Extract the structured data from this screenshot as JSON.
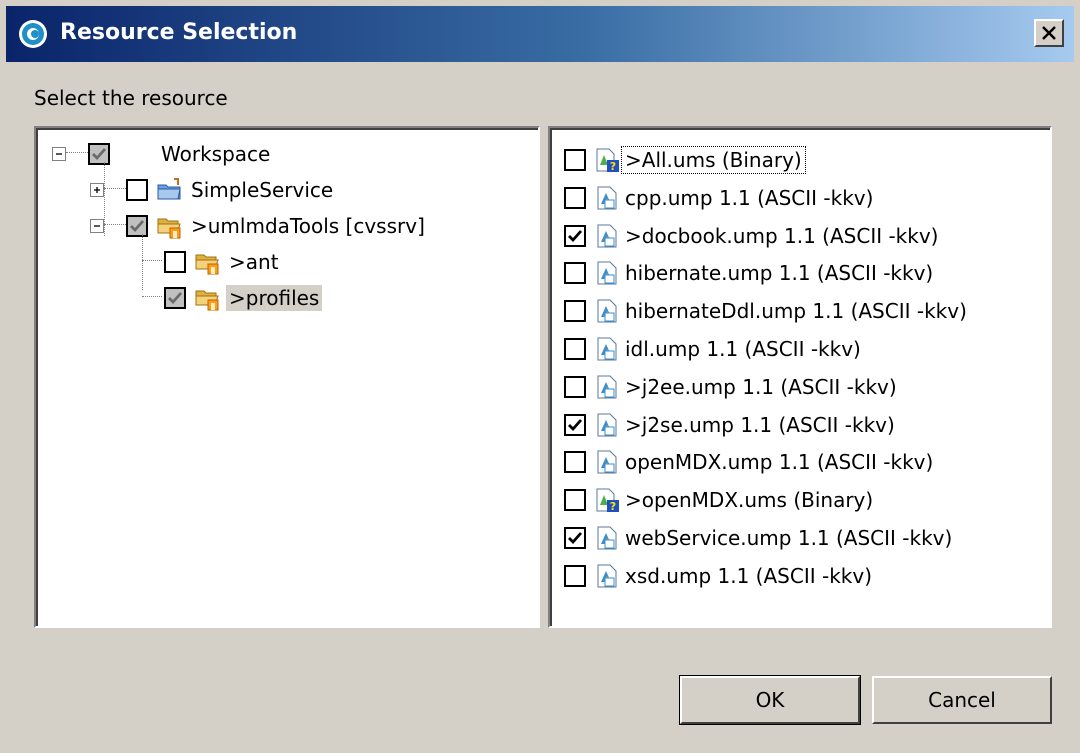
{
  "window": {
    "title": "Resource Selection"
  },
  "prompt": "Select the resource",
  "tree": [
    {
      "label": "Workspace",
      "state": "grayed",
      "expander": "minus",
      "icon": "none"
    },
    {
      "label": "SimpleService",
      "state": "unchecked",
      "expander": "plus",
      "icon": "project-folder-icon"
    },
    {
      "label": ">umlmdaTools  [cvssrv]",
      "state": "grayed",
      "expander": "minus",
      "icon": "shared-folder-icon"
    },
    {
      "label": ">ant",
      "state": "unchecked",
      "expander": "none",
      "icon": "shared-folder-icon"
    },
    {
      "label": ">profiles",
      "state": "grayed",
      "expander": "none",
      "icon": "shared-folder-icon",
      "selected": true
    }
  ],
  "files": [
    {
      "label": ">All.ums   (Binary)",
      "checked": false,
      "icon": "unknown-file-icon",
      "focused": true
    },
    {
      "label": "cpp.ump  1.1  (ASCII -kkv)",
      "checked": false,
      "icon": "ump-file-icon"
    },
    {
      "label": ">docbook.ump  1.1  (ASCII -kkv)",
      "checked": true,
      "icon": "ump-file-icon"
    },
    {
      "label": "hibernate.ump  1.1  (ASCII -kkv)",
      "checked": false,
      "icon": "ump-file-icon"
    },
    {
      "label": "hibernateDdl.ump  1.1  (ASCII -kkv)",
      "checked": false,
      "icon": "ump-file-icon"
    },
    {
      "label": "idl.ump  1.1  (ASCII -kkv)",
      "checked": false,
      "icon": "ump-file-icon"
    },
    {
      "label": ">j2ee.ump  1.1  (ASCII -kkv)",
      "checked": false,
      "icon": "ump-file-icon"
    },
    {
      "label": ">j2se.ump  1.1  (ASCII -kkv)",
      "checked": true,
      "icon": "ump-file-icon"
    },
    {
      "label": "openMDX.ump  1.1  (ASCII -kkv)",
      "checked": false,
      "icon": "ump-file-icon"
    },
    {
      "label": ">openMDX.ums   (Binary)",
      "checked": false,
      "icon": "unknown-file-icon"
    },
    {
      "label": "webService.ump  1.1  (ASCII -kkv)",
      "checked": true,
      "icon": "ump-file-icon"
    },
    {
      "label": "xsd.ump  1.1  (ASCII -kkv)",
      "checked": false,
      "icon": "ump-file-icon"
    }
  ],
  "buttons": {
    "ok": "OK",
    "cancel": "Cancel"
  },
  "colors": {
    "title_start": "#0a246a",
    "title_end": "#a6caf0",
    "dialog_bg": "#d4d0c8",
    "panel_bg": "#ffffff"
  }
}
